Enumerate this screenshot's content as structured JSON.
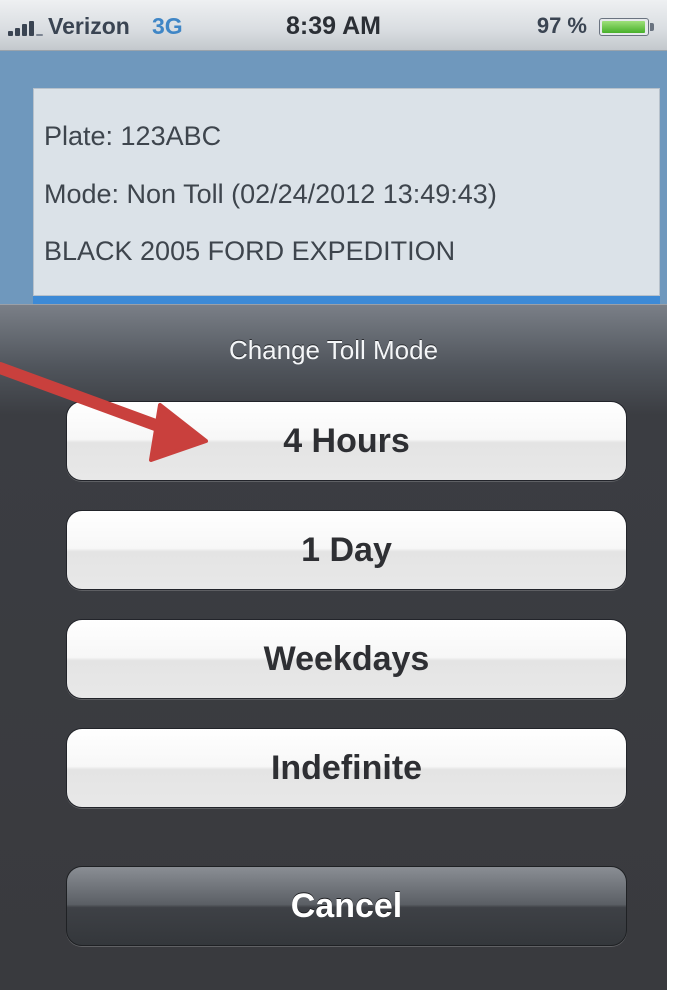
{
  "status_bar": {
    "carrier": "Verizon",
    "network": "3G",
    "time": "8:39 AM",
    "battery": "97 %",
    "battery_level": 0.97,
    "signal_icon": "signal-bars-icon",
    "battery_icon": "battery-icon"
  },
  "vehicle": {
    "plate": "Plate: 123ABC",
    "mode": "Mode: Non Toll (02/24/2012 13:49:43)",
    "description": "BLACK 2005 FORD EXPEDITION"
  },
  "action_sheet": {
    "title": "Change Toll Mode",
    "options": [
      {
        "label": "4 Hours"
      },
      {
        "label": "1 Day"
      },
      {
        "label": "Weekdays"
      },
      {
        "label": "Indefinite"
      }
    ],
    "cancel_label": "Cancel"
  },
  "annotation": {
    "arrow_icon": "red-arrow-icon",
    "arrow_color": "#c9403d"
  },
  "colors": {
    "network_accent": "#3f86c6",
    "stripe_accent": "#3d8ad6",
    "sheet_background": "#393a3e"
  }
}
